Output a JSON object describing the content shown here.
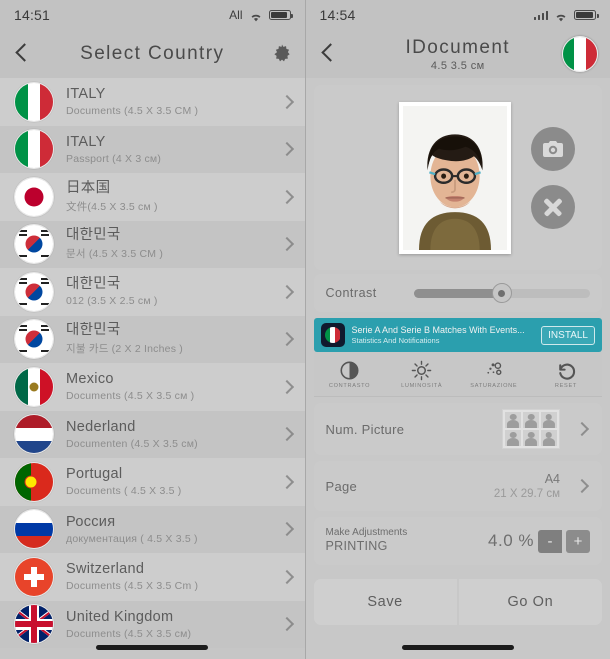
{
  "left": {
    "status": {
      "time": "14:51",
      "carrier_label": "All",
      "wifi_icon": "wifi-icon",
      "battery_icon": "battery-icon"
    },
    "nav": {
      "back_icon": "back-chevron-icon",
      "title": "Select Country",
      "settings_icon": "gear-icon"
    },
    "items": [
      {
        "country": "ITALY",
        "detail": "Documents (4.5 X 3.5 CM )",
        "flag": "italy"
      },
      {
        "country": "ITALY",
        "detail": "Passport (4 X 3 см)",
        "flag": "italy"
      },
      {
        "country": "日本国",
        "detail": "文件(4.5 X 3.5 см )",
        "flag": "japan"
      },
      {
        "country": "대한민국",
        "detail": "문서 (4.5 X 3.5 CM )",
        "flag": "korea"
      },
      {
        "country": "대한민국",
        "detail": "012 (3.5 X 2.5 см )",
        "flag": "korea"
      },
      {
        "country": "대한민국",
        "detail": "지불 카드 (2 X 2 Inches )",
        "flag": "korea"
      },
      {
        "country": "Mexico",
        "detail": "Documents (4.5 X 3.5 см )",
        "flag": "mexico"
      },
      {
        "country": "Nederland",
        "detail": "Documenten (4.5 X 3.5 см)",
        "flag": "netherlands"
      },
      {
        "country": "Portugal",
        "detail": "Documents ( 4.5 X 3.5 )",
        "flag": "portugal"
      },
      {
        "country": "Россия",
        "detail": "документация ( 4.5 X 3.5 )",
        "flag": "russia"
      },
      {
        "country": "Switzerland",
        "detail": "Documents (4.5 X 3.5 Cm )",
        "flag": "switzerland"
      },
      {
        "country": "United Kingdom",
        "detail": "Documents (4.5 X 3.5 см)",
        "flag": "uk"
      }
    ]
  },
  "right": {
    "status": {
      "time": "14:54",
      "signal_icon": "signal-bars-icon",
      "wifi_icon": "wifi-icon",
      "battery_icon": "battery-icon"
    },
    "nav": {
      "back_icon": "back-chevron-icon",
      "title": "IDocument",
      "subtitle": "4.5 3.5 см",
      "flag_icon": "italy-flag-icon"
    },
    "photo": {
      "camera_button_icon": "camera-icon",
      "delete_button_icon": "close-x-icon"
    },
    "contrast": {
      "label": "Contrast",
      "value_percent": 50
    },
    "ad": {
      "line1": "Serie A And Serie B Matches With Events...",
      "line2": "Statistics And Notifications",
      "button": "INSTALL"
    },
    "tools": [
      {
        "label": "CONTRASTO",
        "icon": "contrast-icon"
      },
      {
        "label": "LUMINOSITÀ",
        "icon": "brightness-icon"
      },
      {
        "label": "SATURAZIONE",
        "icon": "saturation-icon"
      },
      {
        "label": "RESET",
        "icon": "reset-arrow-icon"
      }
    ],
    "num_picture": {
      "label": "Num. Picture",
      "thumb_icon": "photo-grid-6-icon",
      "chevron_icon": "chevron-right-icon"
    },
    "page": {
      "label": "Page",
      "size": "A4",
      "dimensions": "21 X 29.7 см",
      "chevron_icon": "chevron-right-icon"
    },
    "adjust": {
      "line1": "Make Adjustments",
      "line2": "PRINTING",
      "value": "4.0 %",
      "minus": "-",
      "plus": "+"
    },
    "buttons": {
      "save": "Save",
      "go_on": "Go On"
    }
  },
  "colors": {
    "accent_ad": "#2b9fae",
    "background": "#c8c8c8",
    "panel": "#cacaca"
  }
}
